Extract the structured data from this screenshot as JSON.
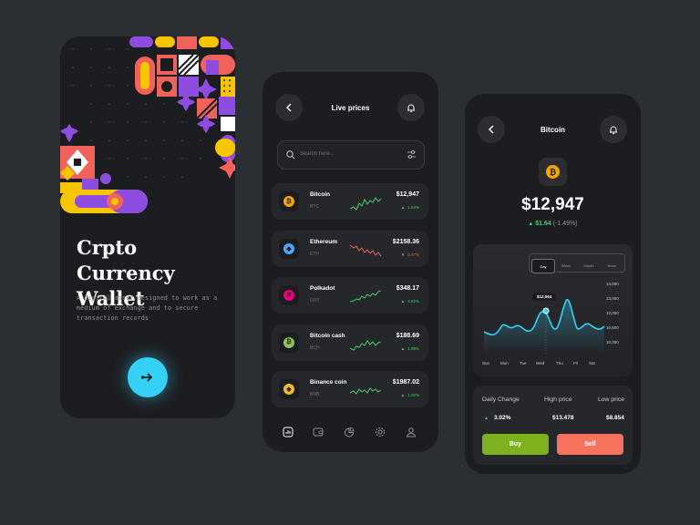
{
  "colors": {
    "background": "#2b2e33",
    "phone": "#1c1d20",
    "card": "#26272b",
    "accent_cyan": "#35d0f5",
    "green": "#3fd36b",
    "red": "#f0625a",
    "yellow": "#f7c600",
    "buy": "#7db21e",
    "sell": "#f8735e"
  },
  "onboarding": {
    "title_line1": "Crpto",
    "title_line2": "Currency Wallet",
    "description": "A digital asset designed to work as a medium of exchange and to secure transaction records",
    "next_icon": "arrow-right-icon"
  },
  "live_prices": {
    "back_icon": "chevron-left-icon",
    "title": "Live prices",
    "bell_icon": "bell-icon",
    "search_placeholder": "Search here..",
    "filter_icon": "sliders-icon",
    "coins": [
      {
        "name": "Bitcoin",
        "symbol": "BTC",
        "price": "$12,947",
        "change": "1.64%",
        "trend": "up",
        "color": "#f7a600",
        "glyph": "₿"
      },
      {
        "name": "Ethereum",
        "symbol": "ETH",
        "price": "$2158.36",
        "change": "0.47%",
        "trend": "down",
        "color": "#4aa8ff",
        "glyph": "◆"
      },
      {
        "name": "Polkadot",
        "symbol": "DOT",
        "price": "$348.17",
        "change": "4.62%",
        "trend": "up",
        "color": "#e6007a",
        "glyph": "P"
      },
      {
        "name": "Bitcoin cash",
        "symbol": "BCH",
        "price": "$188.69",
        "change": "1.98%",
        "trend": "up",
        "color": "#8dc351",
        "glyph": "₿"
      },
      {
        "name": "Binance coin",
        "symbol": "BNB",
        "price": "$1987.02",
        "change": "1.02%",
        "trend": "up",
        "color": "#f3ba2f",
        "glyph": "◈"
      }
    ],
    "nav": [
      "chart-icon",
      "wallet-icon",
      "pie-icon",
      "gear-icon",
      "user-icon"
    ]
  },
  "bitcoin": {
    "back_icon": "chevron-left-icon",
    "title": "Bitcoin",
    "bell_icon": "bell-icon",
    "coin_icon": "bitcoin-icon",
    "price": "$12,947",
    "change_value": "$1.64",
    "change_pct": "(-1.49%)",
    "tabs": [
      "Day",
      "Week",
      "Month",
      "Years"
    ],
    "active_tab": "Day",
    "tooltip": "$12,064",
    "y_ticks": [
      "14,000",
      "13,000",
      "12,000",
      "10,500",
      "10,000"
    ],
    "x_ticks": [
      "Sun",
      "Mon",
      "Tue",
      "Wed",
      "Thu",
      "Fri",
      "Sat"
    ],
    "stats_labels": [
      "Daily Change",
      "High price",
      "Low price"
    ],
    "stats_values": [
      "3.02%",
      "$13.478",
      "$8.854"
    ],
    "buy_label": "Buy",
    "sell_label": "Sell"
  }
}
